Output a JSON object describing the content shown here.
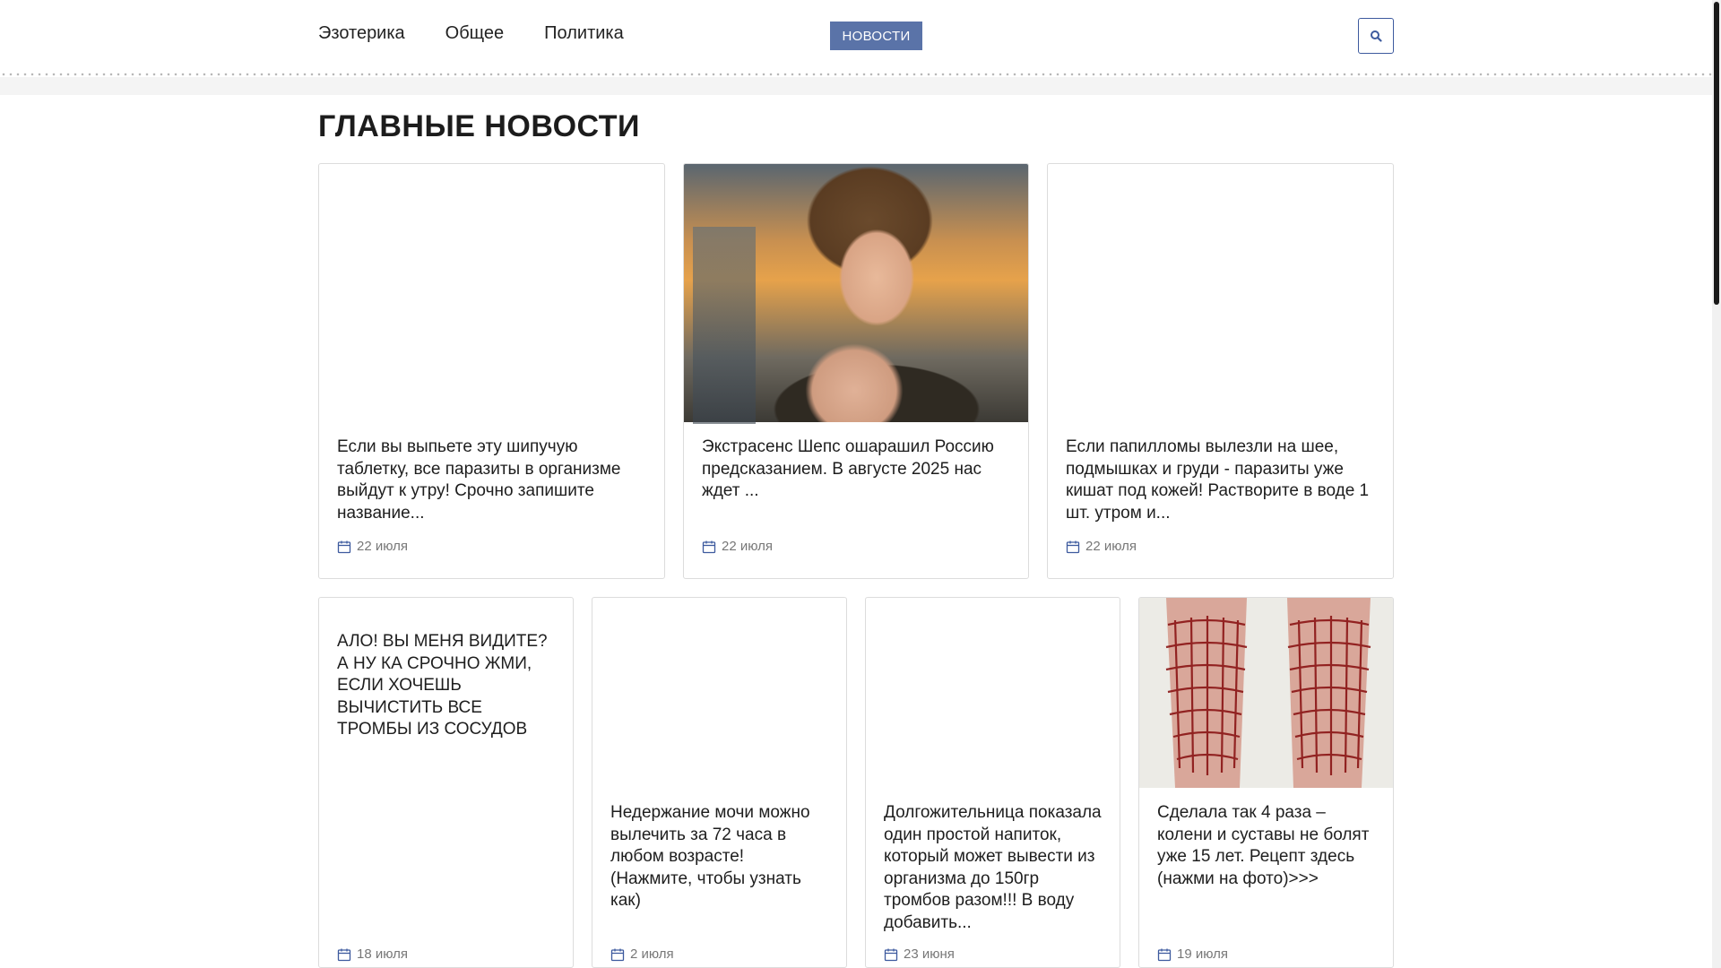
{
  "nav": {
    "items": [
      "Эзотерика",
      "Общее",
      "Политика"
    ],
    "news_button": "НОВОСТИ"
  },
  "section_title": "ГЛАВНЫЕ НОВОСТИ",
  "row1": [
    {
      "text": "Если вы выпьете эту шипучую таблетку, все паразиты в организме выйдут к утру! Срочно запишите название...",
      "date": "22 июля"
    },
    {
      "text": "Экстрасенс Шепс ошарашил Россию предсказанием. В августе 2025 нас ждет ...",
      "date": "22 июля"
    },
    {
      "text": "Если папилломы вылезли на шее, подмышках и груди - паразиты уже кишат под кожей! Растворите в воде 1 шт. утром и...",
      "date": "22 июля"
    }
  ],
  "row2": [
    {
      "text": "АЛО! ВЫ МЕНЯ ВИДИТЕ? А НУ КА СРОЧНО ЖМИ, ЕСЛИ ХОЧЕШЬ ВЫЧИСТИТЬ ВСЕ ТРОМБЫ ИЗ СОСУДОВ",
      "date": "18 июля"
    },
    {
      "text": "Недержание мочи можно вылечить за 72 часа в любом возрасте! (Нажмите, чтобы узнать как)",
      "date": "2 июля"
    },
    {
      "text": "Долгожительница показала один простой напиток, который может вывести из организма до 150гр тромбов разом!!! В воду добавить...",
      "date": "23 июня"
    },
    {
      "text": "Сделала так 4 раза – колени и суставы не болят уже 15 лет. Рецепт здесь (нажми на фото)>>>",
      "date": "19 июля"
    }
  ],
  "colors": {
    "accent": "#5a73a8",
    "icon_blue": "#3d5a9e"
  },
  "icons": [
    "search-icon",
    "calendar-icon"
  ]
}
